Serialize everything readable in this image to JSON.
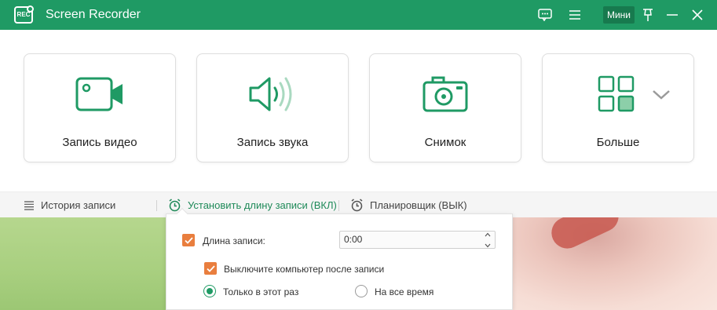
{
  "window": {
    "title": "Screen Recorder",
    "logo_text": "REC",
    "mini_label": "Мини",
    "accent_color": "#1f9a64"
  },
  "cards": [
    {
      "id": "video",
      "label": "Запись видео",
      "icon": "video-camera-icon"
    },
    {
      "id": "audio",
      "label": "Запись звука",
      "icon": "speaker-icon"
    },
    {
      "id": "snapshot",
      "label": "Снимок",
      "icon": "camera-icon"
    },
    {
      "id": "more",
      "label": "Больше",
      "icon": "grid-icon"
    }
  ],
  "toolbar": {
    "history_label": "История записи",
    "length_label": "Установить длину записи (ВКЛ)",
    "scheduler_label": "Планировщик (ВЫК)"
  },
  "length_panel": {
    "length_label": "Длина записи:",
    "length_checked": true,
    "length_value": "0:00",
    "shutdown_label": "Выключите компьютер после записи",
    "shutdown_checked": true,
    "options": [
      {
        "label": "Только в этот раз",
        "selected": true
      },
      {
        "label": "На все время",
        "selected": false
      }
    ],
    "checkbox_color": "#e97e3e"
  }
}
